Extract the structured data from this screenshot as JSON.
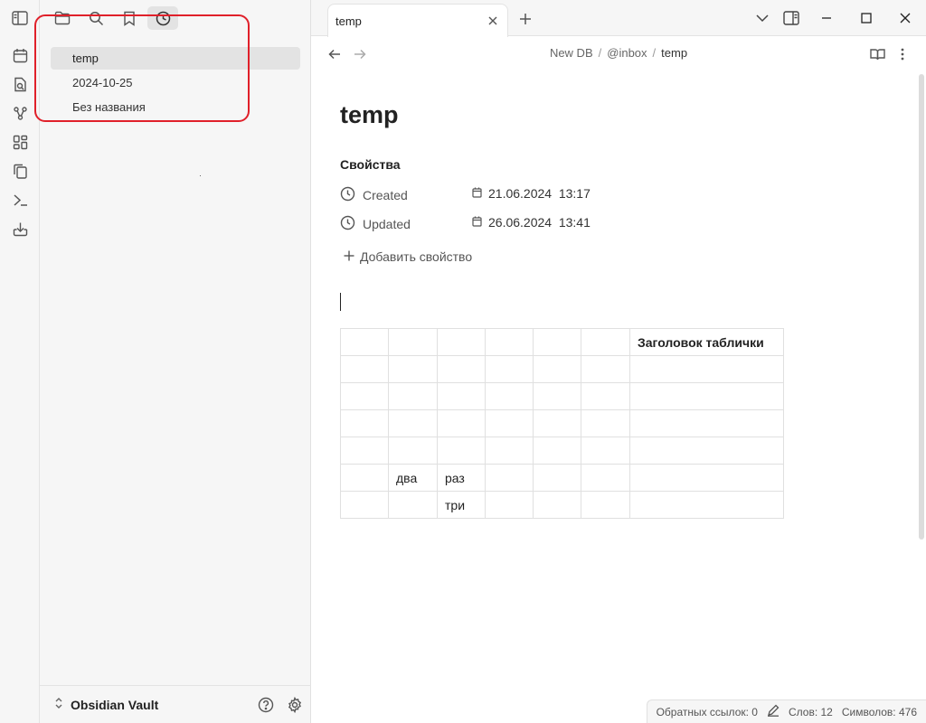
{
  "sidebar": {
    "tabs": [
      {
        "name": "files",
        "icon": "folder-icon"
      },
      {
        "name": "search",
        "icon": "search-icon"
      },
      {
        "name": "bookmarks",
        "icon": "bookmark-icon"
      },
      {
        "name": "recent",
        "icon": "clock-icon",
        "active": true
      }
    ],
    "recent_files": [
      "temp",
      "2024-10-25",
      "Без названия"
    ],
    "vault_name": "Obsidian Vault"
  },
  "tab": {
    "title": "temp"
  },
  "breadcrumb": [
    "New DB",
    "@inbox",
    "temp"
  ],
  "note": {
    "title": "temp",
    "properties_heading": "Свойства",
    "properties": [
      {
        "key": "Created",
        "value": "21.06.2024  13:17"
      },
      {
        "key": "Updated",
        "value": "26.06.2024  13:41"
      }
    ],
    "add_property": "Добавить свойство"
  },
  "table": {
    "rows": [
      [
        "",
        "",
        "",
        "",
        "",
        "",
        "Заголовок таблички"
      ],
      [
        "",
        "",
        "",
        "",
        "",
        "",
        ""
      ],
      [
        "",
        "",
        "",
        "",
        "",
        "",
        ""
      ],
      [
        "",
        "",
        "",
        "",
        "",
        "",
        ""
      ],
      [
        "",
        "",
        "",
        "",
        "",
        "",
        ""
      ],
      [
        "",
        "два",
        "раз",
        "",
        "",
        "",
        ""
      ],
      [
        "",
        "",
        "три",
        "",
        "",
        "",
        ""
      ]
    ]
  },
  "status": {
    "backlinks": "Обратных ссылок: 0",
    "words": "Слов: 12",
    "chars": "Символов: 476"
  },
  "colors": {
    "highlight": "#e0202a",
    "accent": "#7c5cff"
  }
}
